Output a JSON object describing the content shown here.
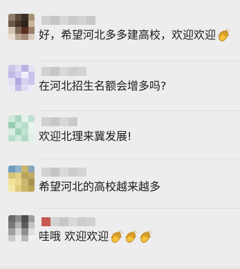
{
  "comments": [
    {
      "text": "好，希望河北多多建高校，欢迎欢迎",
      "emoji_count": 1,
      "avatar_colors": [
        "#8d7a68",
        "#5c4a3b",
        "#3b2c25",
        "#a89378",
        "#6e5a49",
        "#4a3526",
        "#2f2320",
        "#c8b49a",
        "#d4c5b3",
        "#7c6553",
        "#5a2d22",
        "#9b7e66",
        "#e7ddd3",
        "#b8a592",
        "#a48b78",
        "#d9ccbf"
      ],
      "name_colors": [
        "#d0d0d0",
        "#c4c4c4",
        "#d7d7d7",
        "#cbcbcb",
        "#d2d2d2",
        "#c8c8c8"
      ]
    },
    {
      "text": "在河北招生名额会增多吗?",
      "emoji_count": 0,
      "avatar_colors": [
        "#c9c6e6",
        "#dcd8f0",
        "#b7b2e0",
        "#e6e3f6",
        "#bfbae6",
        "#d2cef0",
        "#f0eefa",
        "#c6c1e9",
        "#e3e0f4",
        "#b0aade",
        "#d7d3f1",
        "#cac5ea",
        "#ebe9f8",
        "#c1bce6",
        "#dedbf3",
        "#eeeaf9"
      ],
      "name_colors": [
        "#d1d1d1",
        "#c6c6c6",
        "#d8d8d8",
        "#cdcdcd",
        "#d3d3d3"
      ]
    },
    {
      "text": "欢迎北理来冀发展!",
      "emoji_count": 0,
      "avatar_colors": [
        "#cfe8dc",
        "#a9d6c0",
        "#e2f1ea",
        "#bfe0d0",
        "#99cdb3",
        "#c9e6d8",
        "#b5ddc9",
        "#e9f5ef",
        "#d8ede3",
        "#a2d2ba",
        "#c2e2d2",
        "#e5f3ec",
        "#b8decc",
        "#d0eade",
        "#aed8c4",
        "#dff0e7"
      ],
      "name_colors": [
        "#d0d0d0",
        "#c7c7c7",
        "#d6d6d6",
        "#cacaca"
      ]
    },
    {
      "text": "希望河北的高校越来越多",
      "emoji_count": 0,
      "avatar_colors": [
        "#6f9bbd",
        "#8fb0c9",
        "#c9b56a",
        "#8aa5b9",
        "#d8c478",
        "#e2cf83",
        "#b9a35c",
        "#c2ad63",
        "#f1e39a",
        "#e9d98b",
        "#ccb86d",
        "#a6914f",
        "#f5e9a8",
        "#e0cc7d",
        "#cbb567",
        "#bba457"
      ],
      "name_colors": [
        "#d2d2d2",
        "#c5c5c5",
        "#d9d9d9",
        "#cccccc",
        "#d4d4d4"
      ]
    },
    {
      "text": "哇哦 欢迎欢迎",
      "emoji_count": 3,
      "avatar_colors": [
        "#6a6a6a",
        "#8c8c8c",
        "#4d4d4d",
        "#9c9c9c",
        "#7a7a7a",
        "#b3b3b3",
        "#5c5c5c",
        "#c2c2c2",
        "#a0a0a0",
        "#d6d6d6",
        "#8e8e8e",
        "#e0e0e0",
        "#c8c8c8",
        "#ececec",
        "#b9b9b9",
        "#f2f2f2"
      ],
      "name_colors": [
        "#c85a50",
        "#d3d3d3",
        "#c7c7c7",
        "#d8d8d8",
        "#cdcdcd",
        "#d1d1d1"
      ]
    }
  ],
  "emoji_icon": "clapping-hands-icon"
}
